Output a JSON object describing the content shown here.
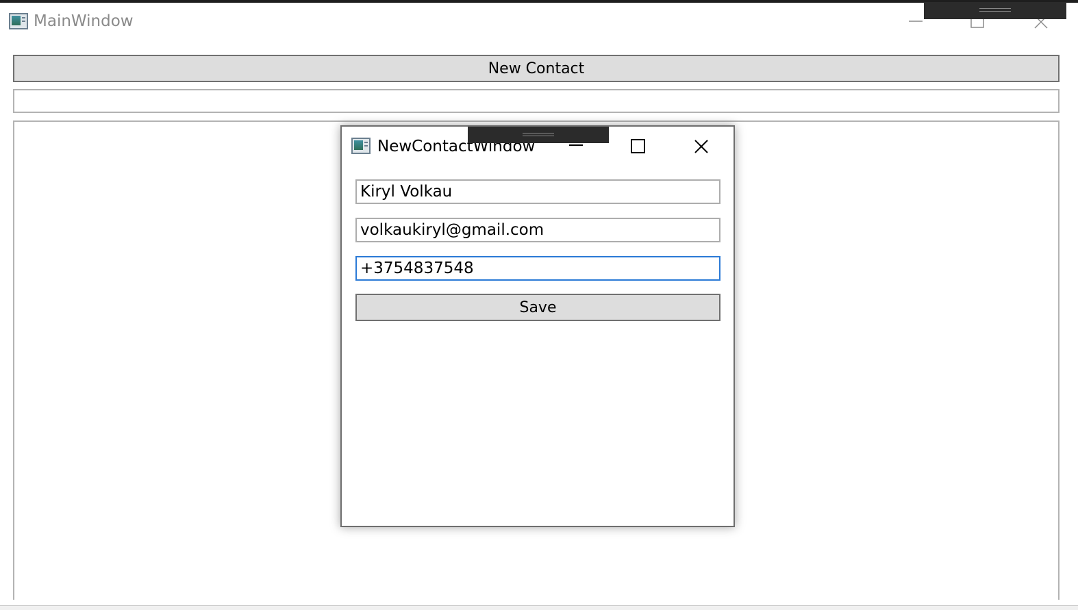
{
  "main_window": {
    "title": "MainWindow",
    "new_contact_label": "New Contact",
    "search_value": ""
  },
  "dialog": {
    "title": "NewContactWindow",
    "name_value": "Kiryl Volkau",
    "email_value": "volkaukiryl@gmail.com",
    "phone_value": "+3754837548",
    "save_label": "Save"
  },
  "colors": {
    "button_bg": "#dddddd",
    "focus_border": "#2b7ad6",
    "drag_bar": "#2b2b2b"
  }
}
